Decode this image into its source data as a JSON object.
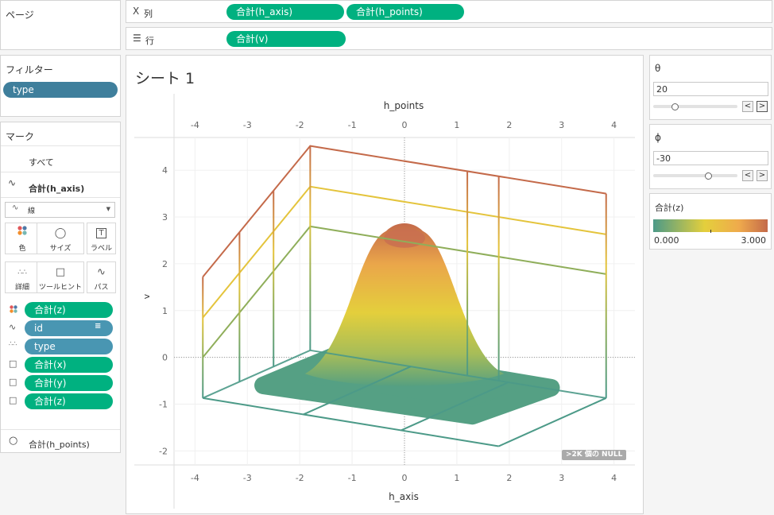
{
  "pages_shelf": {
    "title": "ページ"
  },
  "columns_shelf": {
    "label": "列",
    "pills": [
      "合計(h_axis)",
      "合計(h_points)"
    ]
  },
  "rows_shelf": {
    "label": "行",
    "pills": [
      "合計(v)"
    ]
  },
  "filters": {
    "title": "フィルター",
    "pills": [
      "type"
    ]
  },
  "marks": {
    "title": "マーク",
    "all_label": "すべて",
    "h_axis_label": "合計(h_axis)",
    "mark_type": "線",
    "cards": {
      "color": "色",
      "size": "サイズ",
      "label": "ラベル",
      "detail": "詳細",
      "tooltip": "ツールヒント",
      "path": "パス"
    },
    "fields": [
      {
        "icon": "color-icon",
        "label": "合計(z)",
        "kind": "measure"
      },
      {
        "icon": "path-icon",
        "label": "id",
        "kind": "dimension"
      },
      {
        "icon": "detail-icon",
        "label": "type",
        "kind": "dimension"
      },
      {
        "icon": "tooltip-icon",
        "label": "合計(x)",
        "kind": "measure"
      },
      {
        "icon": "tooltip-icon",
        "label": "合計(y)",
        "kind": "measure"
      },
      {
        "icon": "tooltip-icon",
        "label": "合計(z)",
        "kind": "measure"
      }
    ],
    "h_points_label": "合計(h_points)"
  },
  "sheet": {
    "title": "シート 1",
    "null_badge": ">2K 個の NULL"
  },
  "params": {
    "theta": {
      "title": "θ",
      "value": "20",
      "fraction": 0.25
    },
    "phi": {
      "title": "ϕ",
      "value": "-30",
      "fraction": 0.65
    },
    "step_prev": "<",
    "step_next": ">"
  },
  "legend": {
    "title": "合計(z)",
    "min": "0.000",
    "max": "3.000",
    "colors": [
      "#4c9a88",
      "#e4cf3c",
      "#efaa4c",
      "#c46a4a"
    ]
  },
  "chart_data": {
    "type": "line",
    "top_axis": {
      "title": "h_points",
      "range": [
        -4.4,
        4.4
      ],
      "ticks": [
        -4,
        -3,
        -2,
        -1,
        0,
        1,
        2,
        3,
        4
      ]
    },
    "bottom_axis": {
      "title": "h_axis",
      "range": [
        -4.4,
        4.4
      ],
      "ticks": [
        -4,
        -3,
        -2,
        -1,
        0,
        1,
        2,
        3,
        4
      ]
    },
    "y_axis": {
      "title": "v",
      "range": [
        -2.3,
        4.7
      ],
      "ticks": [
        -2,
        -1,
        0,
        1,
        2,
        3,
        4
      ]
    },
    "box_levels": [
      {
        "level": "z=0",
        "color": "#4c9a88",
        "front_line": [
          [
            -3.85,
            -0.87
          ],
          [
            1.8,
            -1.9
          ]
        ],
        "right_line": [
          [
            1.8,
            -1.9
          ],
          [
            3.85,
            -0.87
          ]
        ],
        "back_line": [
          [
            -1.8,
            0.15
          ],
          [
            3.85,
            -0.87
          ]
        ],
        "left_line": [
          [
            -3.85,
            -0.87
          ],
          [
            -1.8,
            0.15
          ]
        ]
      },
      {
        "level": "z=1",
        "color": "#8fae5a",
        "top_line": [
          [
            -3.85,
            0
          ],
          [
            -1.8,
            2.8
          ],
          [
            3.85,
            1.78
          ]
        ]
      },
      {
        "level": "z=2",
        "color": "#e4c43c",
        "top_line": [
          [
            -3.85,
            0.85
          ],
          [
            -1.8,
            3.65
          ],
          [
            3.85,
            2.63
          ]
        ]
      },
      {
        "level": "z=3",
        "color": "#c46a4a",
        "top_line": [
          [
            -3.85,
            1.72
          ],
          [
            -1.8,
            4.52
          ],
          [
            3.85,
            3.5
          ]
        ]
      }
    ],
    "verticals_x": [
      -3.85,
      -3.15,
      -2.5,
      -1.8,
      1.2,
      1.8,
      3.85
    ],
    "surface": {
      "peak": [
        0,
        2.75
      ],
      "max_z": 3.0
    }
  }
}
